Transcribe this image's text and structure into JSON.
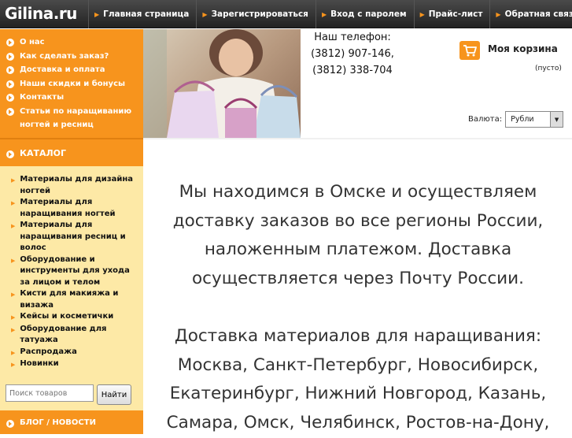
{
  "logo": "Gilina.ru",
  "nav": [
    "Главная страница",
    "Зарегистрироваться",
    "Вход с паролем",
    "Прайс-лист",
    "Обратная связь"
  ],
  "side_menu": [
    "О нас",
    "Как сделать заказ?",
    "Доставка и оплата",
    "Наши скидки и бонусы",
    "Контакты",
    "Статьи по наращиванию ногтей и ресниц"
  ],
  "catalog": {
    "title": "КАТАЛОГ",
    "items": [
      "Материалы для дизайна ногтей",
      "Материалы для наращивания ногтей",
      "Материалы для наращивания ресниц и волос",
      "Оборудование и инструменты для ухода за лицом и телом",
      "Кисти для макияжа и визажа",
      "Кейсы и косметички",
      "Оборудование для татуажа",
      "Распродажа",
      "Новинки"
    ]
  },
  "search": {
    "placeholder": "Поиск товаров",
    "button": "Найти"
  },
  "blog_title": "БЛОГ / НОВОСТИ",
  "phone": {
    "label": "Наш телефон:",
    "numbers": [
      "(3812) 907-146,",
      "(3812) 338-704"
    ]
  },
  "cart": {
    "title": "Моя корзина",
    "status": "(пусто)"
  },
  "currency": {
    "label": "Валюта:",
    "selected": "Рубли"
  },
  "main": {
    "para1": [
      "Мы находимся в Омске и осуществляем",
      "доставку заказов во все регионы России,",
      "наложенным платежом. Доставка",
      "осуществляется через Почту России."
    ],
    "para2": [
      "Доставка материалов для наращивания:",
      "Москва, Санкт-Петербург, Новосибирск,",
      "Екатеринбург, Нижний Новгород, Казань,",
      "Самара, Омск, Челябинск, Ростов-на-Дону,"
    ]
  },
  "colors": {
    "accent": "#f7941d",
    "sidebar_bg": "#fde9a6",
    "topbar": "#333333"
  }
}
